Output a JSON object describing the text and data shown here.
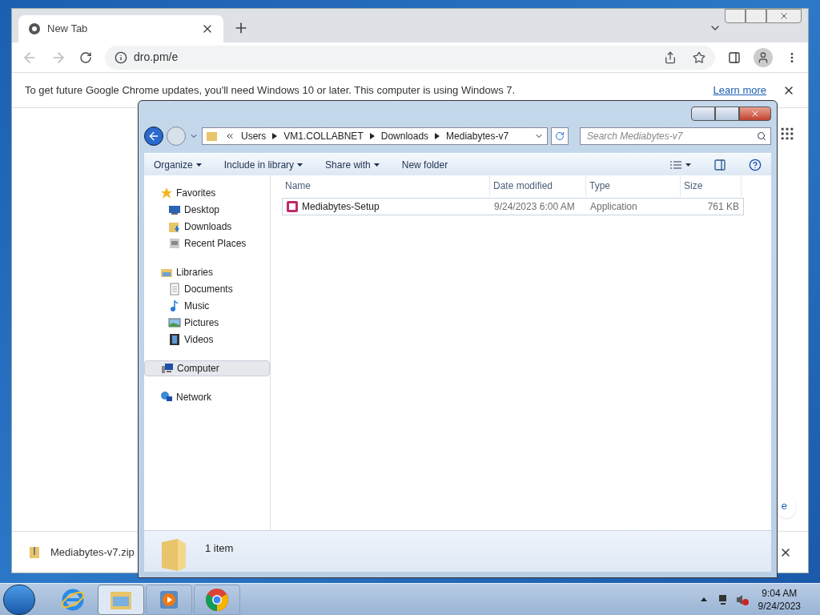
{
  "browser": {
    "tab": {
      "title": "New Tab"
    },
    "address": "dro.pm/e",
    "infobar": {
      "message": "To get future Google Chrome updates, you'll need Windows 10 or later. This computer is using Windows 7.",
      "link": "Learn more"
    },
    "partial_button": "e",
    "download": {
      "file": "Mediabytes-v7.zip"
    }
  },
  "explorer": {
    "breadcrumb": [
      "Users",
      "VM1.COLLABNET",
      "Downloads",
      "Mediabytes-v7"
    ],
    "search": {
      "placeholder": "Search Mediabytes-v7"
    },
    "commands": [
      {
        "label": "Organize",
        "dropdown": true
      },
      {
        "label": "Include in library",
        "dropdown": true
      },
      {
        "label": "Share with",
        "dropdown": true
      },
      {
        "label": "New folder",
        "dropdown": false
      }
    ],
    "nav": [
      {
        "label": "Favorites",
        "kind": "star",
        "selected": false,
        "children": [
          {
            "label": "Desktop",
            "kind": "desktop",
            "selected": false
          },
          {
            "label": "Downloads",
            "kind": "downloads",
            "selected": false
          },
          {
            "label": "Recent Places",
            "kind": "recent",
            "selected": false
          }
        ]
      },
      {
        "label": "Libraries",
        "kind": "library",
        "selected": false,
        "children": [
          {
            "label": "Documents",
            "kind": "documents",
            "selected": false
          },
          {
            "label": "Music",
            "kind": "music",
            "selected": false
          },
          {
            "label": "Pictures",
            "kind": "pictures",
            "selected": false
          },
          {
            "label": "Videos",
            "kind": "videos",
            "selected": false
          }
        ]
      },
      {
        "label": "Computer",
        "kind": "computer",
        "selected": true
      },
      {
        "label": "Network",
        "kind": "network",
        "selected": false
      }
    ],
    "columns": [
      "Name",
      "Date modified",
      "Type",
      "Size"
    ],
    "rows": [
      {
        "name": "Mediabytes-Setup",
        "date": "9/24/2023 6:00 AM",
        "type": "Application",
        "size": "761 KB",
        "selected": false
      }
    ],
    "status": "1 item"
  },
  "taskbar": {
    "apps": [
      {
        "kind": "ie",
        "selected": false
      },
      {
        "kind": "explorer",
        "selected": true
      },
      {
        "kind": "media",
        "selected": false
      },
      {
        "kind": "chrome",
        "selected": false
      }
    ],
    "time": "9:04 AM",
    "date": "9/24/2023"
  }
}
